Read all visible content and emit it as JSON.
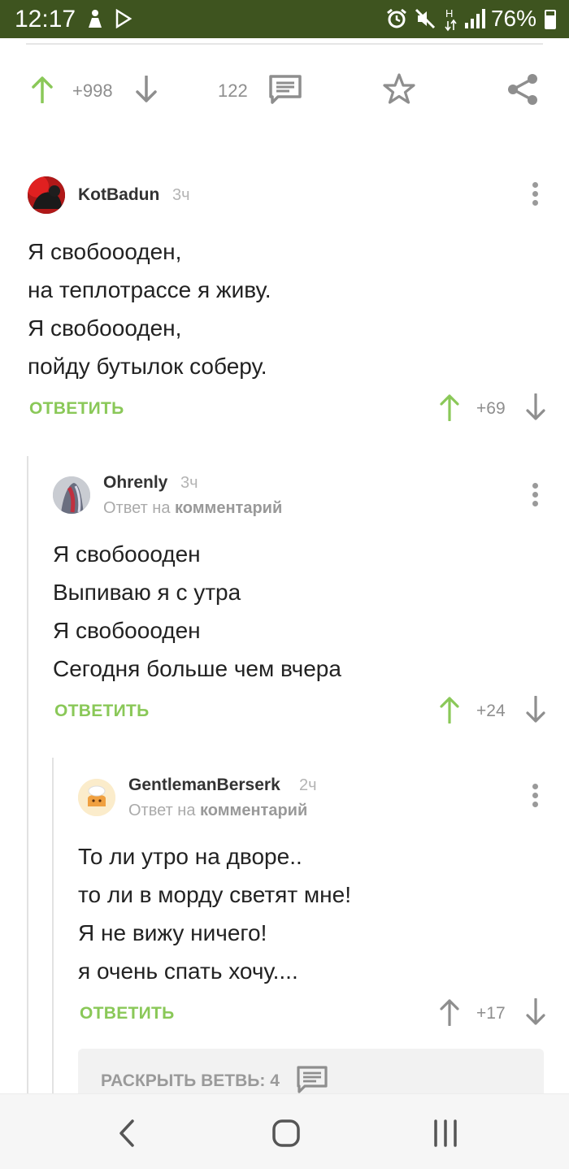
{
  "status_bar": {
    "time": "12:17",
    "battery": "76%",
    "battery_level": 0.76,
    "icons": [
      "person-icon",
      "play-store-icon",
      "alarm-icon",
      "mute-icon",
      "data-h-icon",
      "signal-icon",
      "battery-icon"
    ]
  },
  "post_actions": {
    "rating": "+998",
    "comments_count": "122",
    "icons": [
      "upvote-icon",
      "downvote-icon",
      "comments-icon",
      "star-icon",
      "share-icon"
    ]
  },
  "colors": {
    "status_bar_bg": "#3e541f",
    "accent_green": "#8ac858",
    "muted": "#8e8e8e"
  },
  "comments": [
    {
      "author": "KotBadun",
      "time": "3ч",
      "lines": [
        "Я свобоооден,",
        "на теплотрассе я живу.",
        "Я свобоооден,",
        "пойду бутылок соберу."
      ],
      "reply_label": "ОТВЕТИТЬ",
      "score": "+69"
    },
    {
      "author": "Ohrenly",
      "time": "3ч",
      "reply_prefix": "Ответ на",
      "reply_target": "комментарий",
      "lines": [
        "Я свобоооден",
        "Выпиваю я с утра",
        "Я свобоооден",
        "Сегодня больше чем вчера"
      ],
      "reply_label": "ОТВЕТИТЬ",
      "score": "+24"
    },
    {
      "author": "GentlemanBerserk",
      "time": "2ч",
      "reply_prefix": "Ответ на",
      "reply_target": "комментарий",
      "lines": [
        "То ли утро на дворе..",
        "то ли в морду светят мне!",
        "Я не вижу ничего!",
        "я очень спать хочу...."
      ],
      "reply_label": "ОТВЕТИТЬ",
      "score": "+17"
    }
  ],
  "expand_branch": {
    "label": "РАСКРЫТЬ ВЕТВЬ: 4"
  },
  "nav_bar": {
    "icons": [
      "back-icon",
      "home-icon",
      "recents-icon"
    ]
  }
}
